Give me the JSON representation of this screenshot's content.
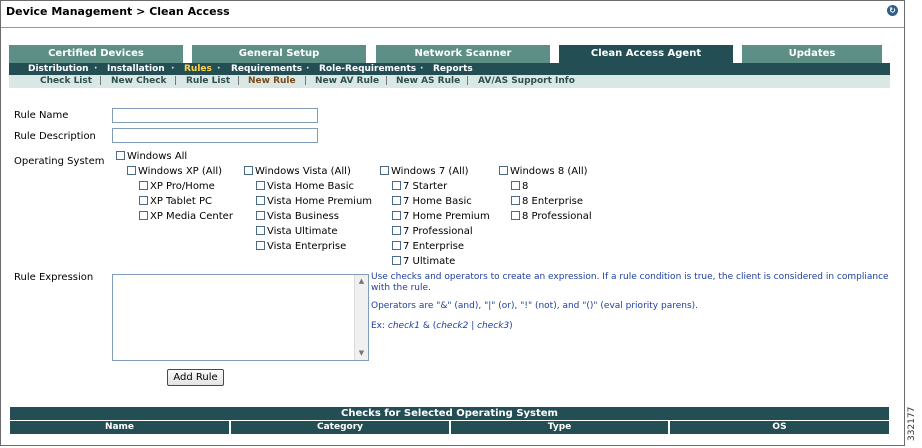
{
  "header": {
    "title": "Device Management > Clean Access",
    "refresh_icon": "refresh-icon"
  },
  "tabs": [
    {
      "label": "Certified Devices"
    },
    {
      "label": "General Setup"
    },
    {
      "label": "Network Scanner"
    },
    {
      "label": "Clean Access Agent",
      "active": true
    },
    {
      "label": "Updates"
    }
  ],
  "subnav": [
    "Distribution",
    "Installation",
    "Rules",
    "Requirements",
    "Role-Requirements",
    "Reports"
  ],
  "subnav_selected": "Rules",
  "thirdnav": [
    "Check List",
    "New Check",
    "Rule List",
    "New Rule",
    "New AV Rule",
    "New AS Rule",
    "AV/AS Support Info"
  ],
  "thirdnav_selected": "New Rule",
  "form": {
    "rule_name_label": "Rule Name",
    "rule_description_label": "Rule Description",
    "os_label": "Operating System",
    "rule_expression_label": "Rule Expression",
    "rule_name_value": "",
    "rule_description_value": ""
  },
  "os": {
    "all": "Windows All",
    "xp": {
      "label": "Windows XP (All)",
      "items": [
        "XP Pro/Home",
        "XP Tablet PC",
        "XP Media Center"
      ]
    },
    "vista": {
      "label": "Windows Vista (All)",
      "items": [
        "Vista Home Basic",
        "Vista Home Premium",
        "Vista Business",
        "Vista Ultimate",
        "Vista Enterprise"
      ]
    },
    "win7": {
      "label": "Windows 7 (All)",
      "items": [
        "7 Starter",
        "7 Home Basic",
        "7 Home Premium",
        "7 Professional",
        "7 Enterprise",
        "7 Ultimate"
      ]
    },
    "win8": {
      "label": "Windows 8 (All)",
      "items": [
        "8",
        "8 Enterprise",
        "8 Professional"
      ]
    }
  },
  "help": {
    "line1": "Use checks and operators to create an expression. If a rule condition is true, the client is considered in compliance with the rule.",
    "line2": "Operators are \"&\" (and), \"|\" (or), \"!\" (not), and \"()\" (eval priority parens).",
    "ex_prefix": "Ex: ",
    "ex_c1": "check1",
    "ex_mid1": " & (",
    "ex_c2": "check2",
    "ex_mid2": " | ",
    "ex_c3": "check3",
    "ex_end": ")"
  },
  "add_rule_label": "Add Rule",
  "checks_table": {
    "title": "Checks for Selected Operating System",
    "columns": [
      "Name",
      "Category",
      "Type",
      "OS"
    ]
  },
  "side_id": "332177",
  "colors": {
    "tab": "#5d8f86",
    "tab_active": "#234e54",
    "subnav": "#234e54",
    "thirdnav": "#d9e8e4",
    "help_text": "#1f3f9f"
  }
}
